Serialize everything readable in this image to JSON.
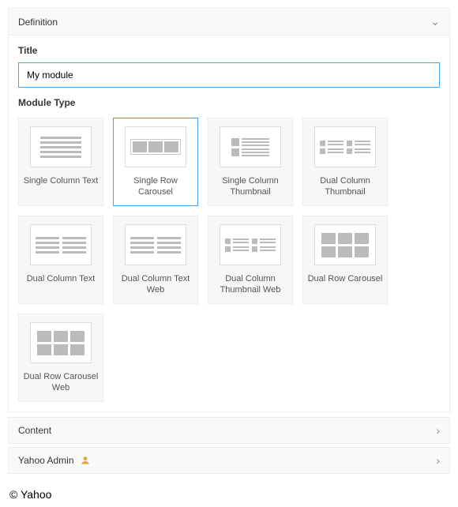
{
  "accordion": {
    "definition": "Definition",
    "content": "Content",
    "yahoo_admin": "Yahoo Admin"
  },
  "title": {
    "label": "Title",
    "value": "My module"
  },
  "module_type": {
    "label": "Module Type",
    "tiles": [
      {
        "label": "Single Column Text"
      },
      {
        "label": "Single Row Carousel"
      },
      {
        "label": "Single Column Thumbnail"
      },
      {
        "label": "Dual Column Thumbnail"
      },
      {
        "label": "Dual Column Text"
      },
      {
        "label": "Dual Column Text Web"
      },
      {
        "label": "Dual Column Thumbnail Web"
      },
      {
        "label": "Dual Row Carousel"
      },
      {
        "label": "Dual Row Carousel Web"
      }
    ],
    "selected_index": 1
  },
  "footer": {
    "copyright": "© Yahoo"
  }
}
